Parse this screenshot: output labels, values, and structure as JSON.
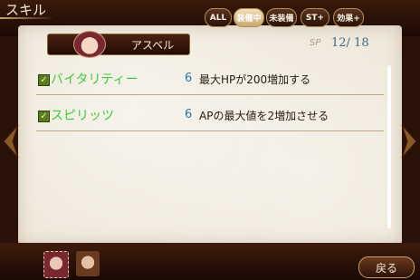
{
  "header": {
    "title": "スキル"
  },
  "filters": [
    {
      "label": "ALL"
    },
    {
      "label": "装備中"
    },
    {
      "label": "未装備"
    },
    {
      "label": "ST+"
    },
    {
      "label": "効果+"
    }
  ],
  "character": {
    "name": "アスベル"
  },
  "sp": {
    "label": "SP",
    "value": "12/ 18"
  },
  "skills": [
    {
      "name": "バイタリティー",
      "cost": "6",
      "description": "最大HPが200増加する",
      "equipped": true
    },
    {
      "name": "スピリッツ",
      "cost": "6",
      "description": "APの最大値を2増加させる",
      "equipped": true
    }
  ],
  "footer": {
    "back_label": "戻る"
  },
  "colors": {
    "accent": "#3ccc3c",
    "cost": "#2a7aa8",
    "frame": "#b68c52"
  }
}
